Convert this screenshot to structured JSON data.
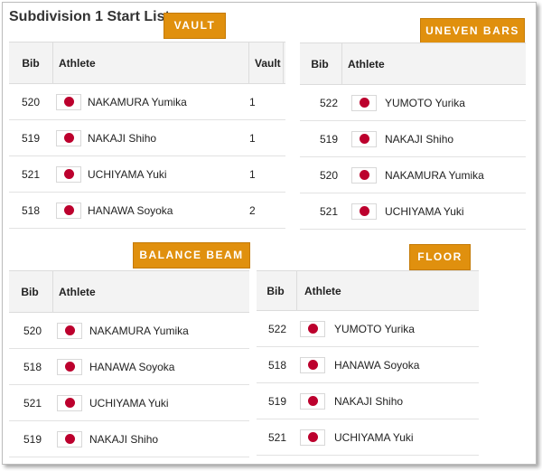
{
  "page_title": "Subdivision 1 Start List",
  "flag_icon": "japan-flag-icon",
  "colors": {
    "badge": "#e0900e",
    "flag_red": "#bc002d"
  },
  "headers": {
    "bib": "Bib",
    "athlete": "Athlete",
    "vault": "Vault"
  },
  "vault": {
    "label": "VAULT",
    "rows": [
      {
        "bib": "520",
        "athlete": "NAKAMURA Yumika",
        "vault": "1"
      },
      {
        "bib": "519",
        "athlete": "NAKAJI Shiho",
        "vault": "1"
      },
      {
        "bib": "521",
        "athlete": "UCHIYAMA Yuki",
        "vault": "1"
      },
      {
        "bib": "518",
        "athlete": "HANAWA Soyoka",
        "vault": "2"
      }
    ]
  },
  "uneven_bars": {
    "label": "UNEVEN BARS",
    "rows": [
      {
        "bib": "522",
        "athlete": "YUMOTO Yurika"
      },
      {
        "bib": "519",
        "athlete": "NAKAJI Shiho"
      },
      {
        "bib": "520",
        "athlete": "NAKAMURA Yumika"
      },
      {
        "bib": "521",
        "athlete": "UCHIYAMA Yuki"
      }
    ]
  },
  "balance_beam": {
    "label": "BALANCE BEAM",
    "rows": [
      {
        "bib": "520",
        "athlete": "NAKAMURA Yumika"
      },
      {
        "bib": "518",
        "athlete": "HANAWA Soyoka"
      },
      {
        "bib": "521",
        "athlete": "UCHIYAMA Yuki"
      },
      {
        "bib": "519",
        "athlete": "NAKAJI Shiho"
      }
    ]
  },
  "floor": {
    "label": "FLOOR",
    "rows": [
      {
        "bib": "522",
        "athlete": "YUMOTO Yurika"
      },
      {
        "bib": "518",
        "athlete": "HANAWA Soyoka"
      },
      {
        "bib": "519",
        "athlete": "NAKAJI Shiho"
      },
      {
        "bib": "521",
        "athlete": "UCHIYAMA Yuki"
      }
    ]
  }
}
